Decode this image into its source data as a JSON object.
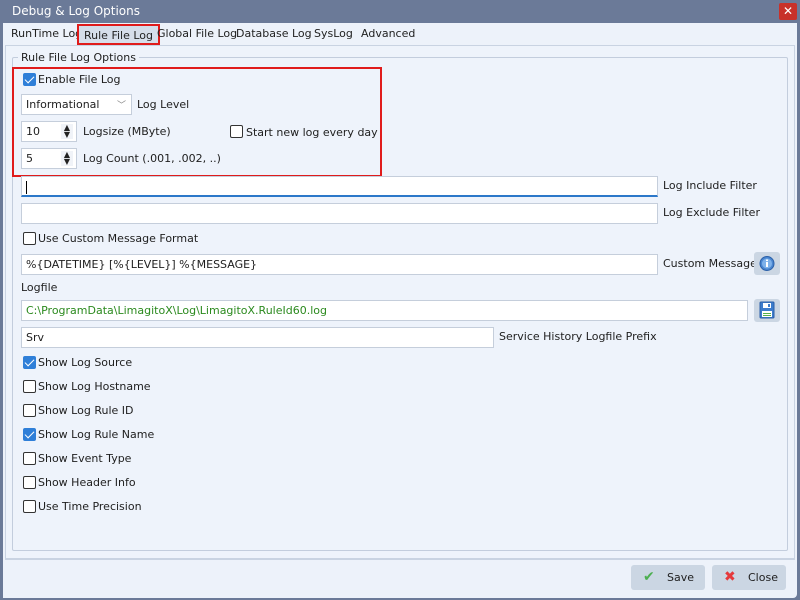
{
  "window": {
    "title": "Debug & Log Options",
    "close_icon": "close-icon"
  },
  "tabs": [
    {
      "label": "RunTime Log",
      "active": false
    },
    {
      "label": "Rule File Log",
      "active": true
    },
    {
      "label": "Global File Log",
      "active": false
    },
    {
      "label": "Database Log",
      "active": false
    },
    {
      "label": "SysLog",
      "active": false
    },
    {
      "label": "Advanced",
      "active": false
    }
  ],
  "group": {
    "title": "Rule File Log Options"
  },
  "enable_file_log": {
    "label": "Enable File Log",
    "checked": true
  },
  "log_level": {
    "value": "Informational",
    "label": "Log Level"
  },
  "logsize": {
    "value": "10",
    "label": "Logsize (MByte)"
  },
  "start_new_log": {
    "label": "Start new log every day",
    "checked": false
  },
  "log_count": {
    "value": "5",
    "label": "Log Count (.001, .002, ..)"
  },
  "include_filter": {
    "value": "",
    "label": "Log Include Filter"
  },
  "exclude_filter": {
    "value": "",
    "label": "Log Exclude Filter"
  },
  "custom_format": {
    "label": "Use Custom Message Format",
    "checked": false
  },
  "custom_message": {
    "value": "%{DATETIME} [%{LEVEL}] %{MESSAGE}",
    "label": "Custom Message",
    "icon": "info-icon"
  },
  "logfile": {
    "label": "Logfile",
    "value": "C:\\ProgramData\\LimagitoX\\Log\\LimagitoX.RuleId60.log",
    "icon": "save-disk-icon",
    "value_color": "#2b8a1e"
  },
  "service_prefix": {
    "value": "Srv",
    "label": "Service History Logfile Prefix"
  },
  "options": [
    {
      "label": "Show Log Source",
      "checked": true
    },
    {
      "label": "Show Log Hostname",
      "checked": false
    },
    {
      "label": "Show Log Rule ID",
      "checked": false
    },
    {
      "label": "Show Log Rule Name",
      "checked": true
    },
    {
      "label": "Show Event Type",
      "checked": false
    },
    {
      "label": "Show Header Info",
      "checked": false
    },
    {
      "label": "Use Time Precision",
      "checked": false
    }
  ],
  "footer": {
    "save_label": "Save",
    "close_label": "Close"
  },
  "colors": {
    "accent": "#2f7fd8",
    "highlight_box": "#e01b1b",
    "titlebar": "#6b7a98"
  }
}
